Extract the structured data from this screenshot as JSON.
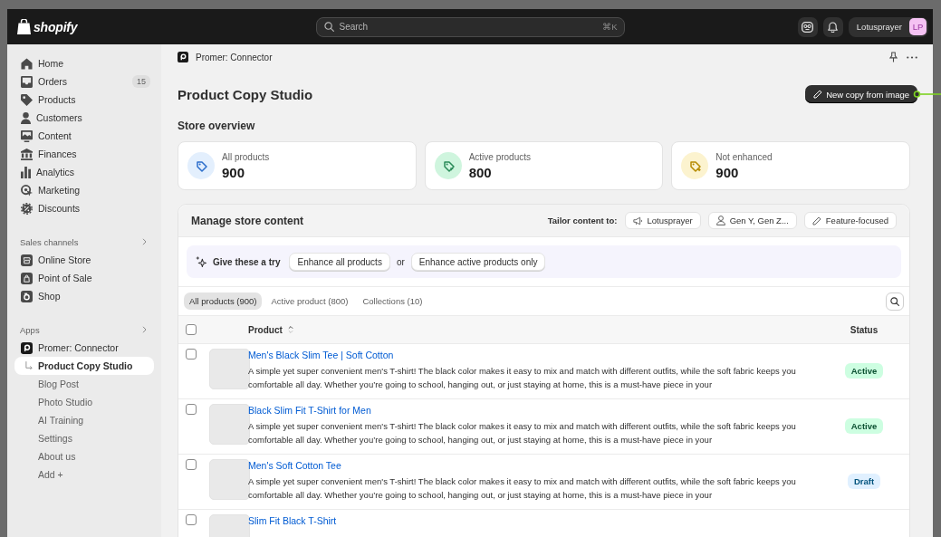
{
  "top_bar": {
    "logo_text": "shopify",
    "search": {
      "placeholder": "Search",
      "shortcut": "⌘K"
    },
    "user": {
      "name": "Lotusprayer",
      "initials": "LP"
    }
  },
  "sidebar": {
    "items": [
      {
        "label": "Home",
        "selected": false
      },
      {
        "label": "Orders",
        "badge": "15",
        "selected": false
      },
      {
        "label": "Products",
        "selected": false
      },
      {
        "label": "Customers",
        "selected": false
      },
      {
        "label": "Content",
        "selected": false
      },
      {
        "label": "Finances",
        "selected": false
      },
      {
        "label": "Analytics",
        "selected": false
      },
      {
        "label": "Marketing",
        "selected": false
      },
      {
        "label": "Discounts",
        "selected": false
      }
    ],
    "sections": [
      {
        "title": "Sales channels",
        "items": [
          {
            "label": "Online Store",
            "selected": false
          },
          {
            "label": "Point of Sale",
            "selected": false
          },
          {
            "label": "Shop",
            "selected": false
          }
        ]
      },
      {
        "title": "Apps",
        "items": [
          {
            "label": "Promer: Connector",
            "selected": false,
            "children": [
              {
                "label": "Product Copy Studio",
                "selected": true
              },
              {
                "label": "Blog Post",
                "selected": false
              },
              {
                "label": "Photo Studio",
                "selected": false
              },
              {
                "label": "AI Training",
                "selected": false
              },
              {
                "label": "Settings",
                "selected": false
              },
              {
                "label": "About us",
                "selected": false
              },
              {
                "label": "Add +",
                "selected": false
              }
            ]
          }
        ]
      }
    ]
  },
  "breadcrumb": {
    "label": "Promer: Connector"
  },
  "page": {
    "title": "Product Copy Studio",
    "primary_action": "New copy from image"
  },
  "overview": {
    "title": "Store overview",
    "stats": [
      {
        "label": "All products",
        "value": "900"
      },
      {
        "label": "Active products",
        "value": "800"
      },
      {
        "label": "Not enhanced",
        "value": "900"
      }
    ]
  },
  "manage": {
    "title": "Manage store content",
    "tailor": {
      "label": "Tailor content to:",
      "options": [
        "Lotusprayer",
        "Gen Y, Gen Z...",
        "Feature-focused"
      ]
    },
    "suggestion": {
      "label": "Give these a try",
      "actions": [
        "Enhance all products",
        "Enhance active products only"
      ],
      "separator": "or"
    },
    "tabs": [
      {
        "label": "All products (900)",
        "selected": true
      },
      {
        "label": "Active product (800)",
        "selected": false
      },
      {
        "label": "Collections (10)",
        "selected": false
      }
    ],
    "table": {
      "header_checked": false,
      "columns": [
        "Product",
        "Status"
      ],
      "rows": [
        {
          "title": "Men's Black Slim Tee | Soft Cotton",
          "description": "A simple yet super convenient men's T-shirt! The black color makes it easy to mix and match with different outfits, while the soft fabric keeps you comfortable all day. Whether you’re going to school, hanging out, or just staying at home, this is a must-have piece in your",
          "status": {
            "label": "Active",
            "kind": "success"
          },
          "checked": false
        },
        {
          "title": "Black Slim Fit T-Shirt for Men",
          "description": "A simple yet super convenient men's T-shirt! The black color makes it easy to mix and match with different outfits, while the soft fabric keeps you comfortable all day. Whether you’re going to school, hanging out, or just staying at home, this is a must-have piece in your",
          "status": {
            "label": "Active",
            "kind": "success"
          },
          "checked": false
        },
        {
          "title": "Men's Soft Cotton Tee",
          "description": "A simple yet super convenient men's T-shirt! The black color makes it easy to mix and match with different outfits, while the soft fabric keeps you comfortable all day. Whether you’re going to school, hanging out, or just staying at home, this is a must-have piece in your",
          "status": {
            "label": "Draft",
            "kind": "info"
          },
          "checked": false
        },
        {
          "title": "Slim Fit Black T-Shirt",
          "checked": false
        }
      ]
    }
  }
}
